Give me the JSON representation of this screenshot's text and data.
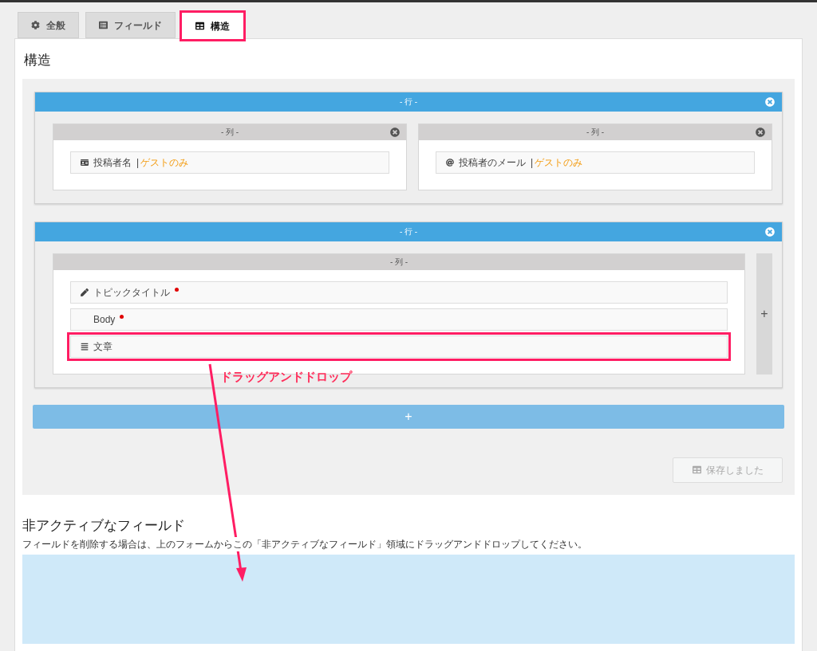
{
  "tabs": [
    {
      "label": "全般",
      "kind": "general",
      "selected": false,
      "highlighted": false
    },
    {
      "label": "フィールド",
      "kind": "fields",
      "selected": false,
      "highlighted": false
    },
    {
      "label": "構造",
      "kind": "structure",
      "selected": true,
      "highlighted": true
    }
  ],
  "structure": {
    "title": "構造",
    "rows": [
      {
        "label": "- 行 -",
        "add_column": null,
        "columns": [
          {
            "label": "- 列 -",
            "closable": true,
            "fields": [
              {
                "kind": "author-name",
                "label": "投稿者名",
                "separator": "|",
                "note": "ゲストのみ",
                "required": false,
                "highlighted": false
              }
            ]
          },
          {
            "label": "- 列 -",
            "closable": true,
            "fields": [
              {
                "kind": "email",
                "label": "投稿者のメール",
                "separator": "|",
                "note": "ゲストのみ",
                "required": false,
                "highlighted": false
              }
            ]
          }
        ]
      },
      {
        "label": "- 行 -",
        "add_column": "+",
        "columns": [
          {
            "label": "- 列 -",
            "closable": false,
            "fields": [
              {
                "kind": "title",
                "label": "トピックタイトル",
                "required": true,
                "highlighted": false
              },
              {
                "kind": "custom",
                "label": "Body",
                "required": true,
                "highlighted": false
              },
              {
                "kind": "text",
                "label": "文章",
                "required": false,
                "highlighted": true
              }
            ]
          }
        ]
      }
    ],
    "add_row": "+",
    "save_button": {
      "label": "保存しました",
      "disabled": true
    }
  },
  "inactive": {
    "title": "非アクティブなフィールド",
    "description": "フィールドを削除する場合は、上のフォームからこの「非アクティブなフィールド」領域にドラッグアンドドロップしてください。"
  },
  "annotation": {
    "text": "ドラッグアンドドロップ"
  }
}
